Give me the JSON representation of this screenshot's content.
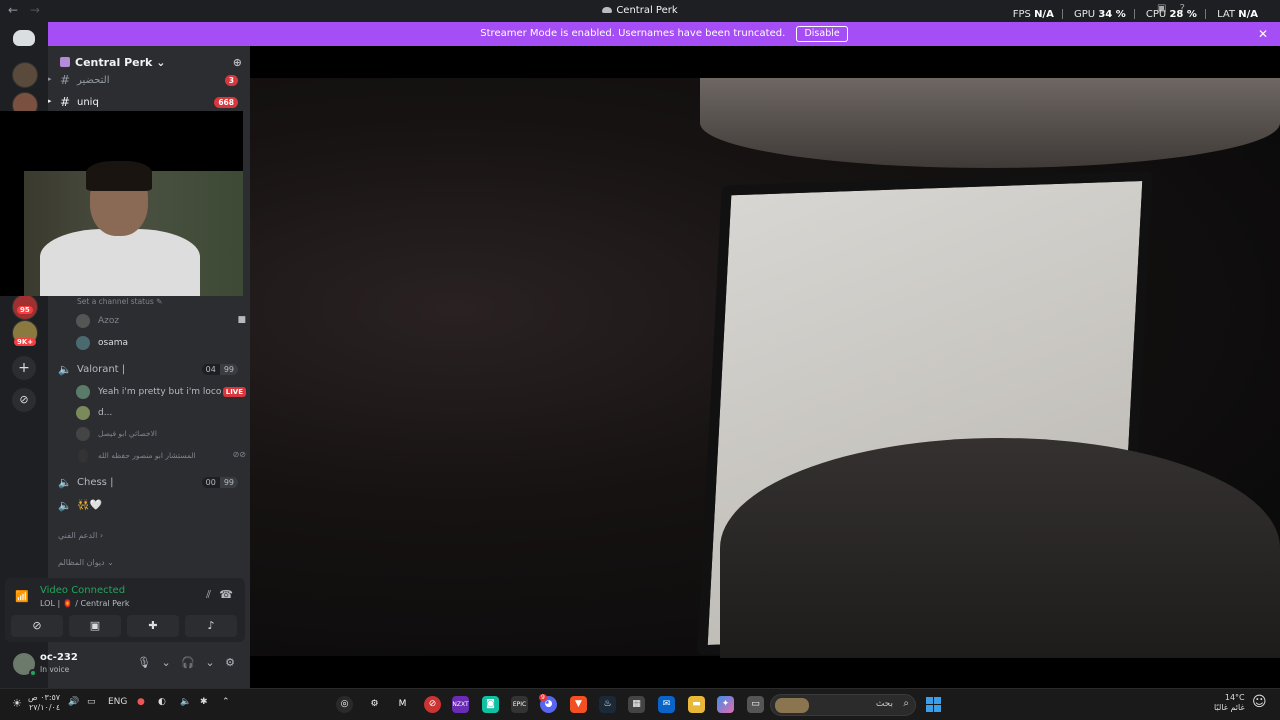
{
  "window": {
    "title": "Central Perk",
    "back": "←",
    "forward": "→"
  },
  "overlay": {
    "fps_label": "FPS",
    "fps_value": "N/A",
    "gpu_label": "GPU",
    "gpu_value": "34 %",
    "cpu_label": "CPU",
    "cpu_value": "28 %",
    "lat_label": "LAT",
    "lat_value": "N/A"
  },
  "banner": {
    "text": "Streamer Mode is enabled. Usernames have been truncated.",
    "button": "Disable",
    "close": "✕"
  },
  "server": {
    "name": "Central Perk",
    "chevron": "⌄"
  },
  "rail": {
    "badge1": "95",
    "badge2": "9K+",
    "add": "+",
    "explore": "⊘"
  },
  "channels": [
    {
      "name": "التحضير",
      "count": "3"
    },
    {
      "name": "uniq",
      "count": "668"
    }
  ],
  "set_status": "Set a channel status",
  "voice_top": {
    "users": [
      {
        "name": "Azoz",
        "has_cam": true
      },
      {
        "name": "osama"
      }
    ]
  },
  "valorant": {
    "name": "Valorant |",
    "pill_a": "04",
    "pill_b": "99",
    "users": [
      {
        "name": "Yeah i'm pretty but i'm loco",
        "live": "LIVE"
      },
      {
        "name": "d..."
      },
      {
        "name": "الاخصائي ابو فيصل"
      },
      {
        "name": "المستشار ابو منصور حفظه الله"
      }
    ]
  },
  "chess": {
    "name": "Chess |",
    "pill_a": "00",
    "pill_b": "99"
  },
  "voice_extra": {
    "emoji": "👯🤍"
  },
  "categories": {
    "support": "الدعم الفني",
    "grievances": "ديوان المظالم"
  },
  "rtc": {
    "status": "Video Connected",
    "location": "LOL | 🏮 / Central Perk",
    "btn_camera": "⊘",
    "btn_screen": "▣",
    "btn_activity": "✚",
    "btn_soundboard": "♪"
  },
  "user": {
    "name": "oc-232",
    "status": "In voice"
  },
  "taskbar": {
    "time": "٠٣:٥٧ ص",
    "date": "٢٧/١٠/٠٤",
    "lang": "ENG",
    "search_label": "بحث",
    "weather_temp": "14°C",
    "weather_desc": "غائم غالبًا",
    "discord_badge": "9"
  }
}
